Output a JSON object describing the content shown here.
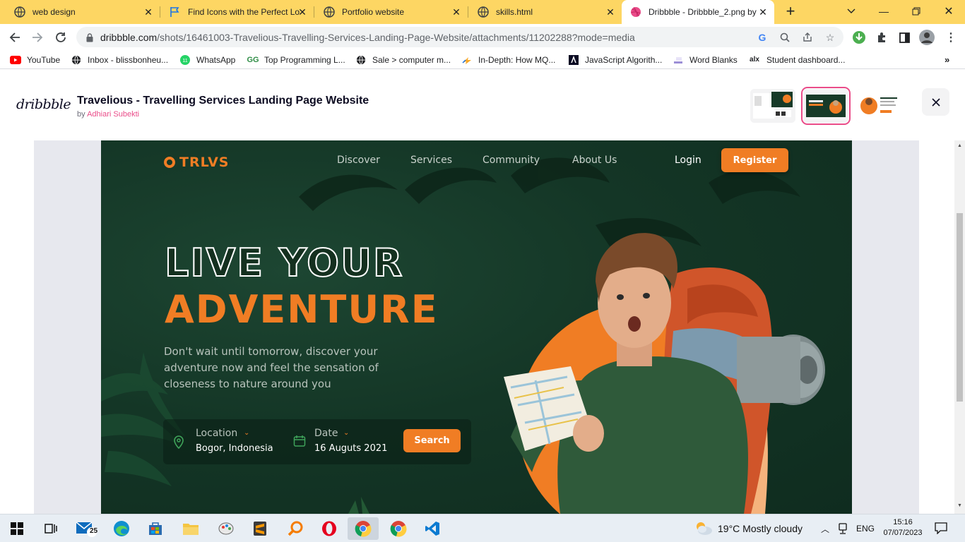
{
  "browser": {
    "tabs": [
      {
        "title": "web design",
        "icon": "globe-icon"
      },
      {
        "title": "Find Icons with the Perfect Lo",
        "icon": "flag-icon"
      },
      {
        "title": "Portfolio website",
        "icon": "globe-icon"
      },
      {
        "title": "skills.html",
        "icon": "globe-icon"
      },
      {
        "title": "Dribbble - Dribbble_2.png by",
        "icon": "dribbble-icon",
        "active": true
      }
    ],
    "url_host": "dribbble.com",
    "url_path": "/shots/16461003-Travelious-Travelling-Services-Landing-Page-Website/attachments/11202288?mode=media",
    "bookmarks": [
      {
        "label": "YouTube",
        "icon": "youtube-icon"
      },
      {
        "label": "Inbox - blissbonheu...",
        "icon": "globe-icon"
      },
      {
        "label": "WhatsApp",
        "icon": "whatsapp-icon"
      },
      {
        "label": "Top Programming L...",
        "icon": "gfg-icon"
      },
      {
        "label": "Sale > computer m...",
        "icon": "globe-icon"
      },
      {
        "label": "In-Depth: How MQ...",
        "icon": "bolt-icon"
      },
      {
        "label": "JavaScript Algorith...",
        "icon": "freecodecamp-icon"
      },
      {
        "label": "Word Blanks",
        "icon": "doc-icon"
      },
      {
        "label": "Student dashboard...",
        "icon": "alx-icon"
      }
    ]
  },
  "dribbble": {
    "logo": "dribbble",
    "title": "Travelious - Travelling Services Landing Page Website",
    "by": "by",
    "author": "Adhiari Subekti",
    "accent": "#ea4c89"
  },
  "shot": {
    "brand": "TRLVS",
    "nav": [
      "Discover",
      "Services",
      "Community",
      "About Us"
    ],
    "login": "Login",
    "register": "Register",
    "headline_1": "LIVE YOUR",
    "headline_2": "ADVENTURE",
    "subtitle": "Don't wait until tomorrow, discover your adventure now and feel the sensation of closeness to nature around you",
    "location_label": "Location",
    "location_value": "Bogor, Indonesia",
    "date_label": "Date",
    "date_value": "16 Auguts 2021",
    "search_label": "Search",
    "accent": "#f07d24",
    "bg": "#143626"
  },
  "taskbar": {
    "mail_badge": "25",
    "weather": "19°C  Mostly cloudy",
    "lang": "ENG",
    "time": "15:16",
    "date": "07/07/2023"
  }
}
